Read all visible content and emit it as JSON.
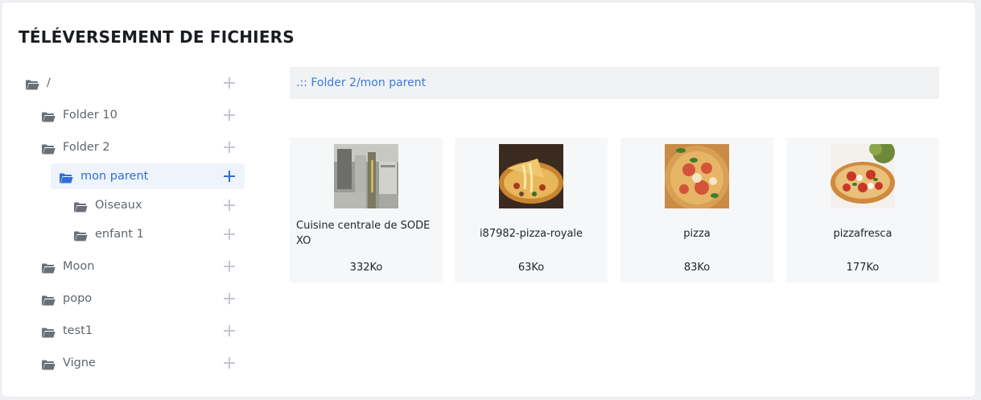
{
  "page": {
    "title": "TÉLÉVERSEMENT DE FICHIERS"
  },
  "tree": {
    "root": {
      "label": "/"
    },
    "items": [
      {
        "label": "Folder 10"
      },
      {
        "label": "Folder 2"
      },
      {
        "label": "mon parent"
      },
      {
        "label": "Oiseaux"
      },
      {
        "label": "enfant 1"
      },
      {
        "label": "Moon"
      },
      {
        "label": "popo"
      },
      {
        "label": "test1"
      },
      {
        "label": "Vigne"
      }
    ],
    "active_item": "mon parent"
  },
  "breadcrumb": {
    "text": ".:: Folder 2/mon parent"
  },
  "files": [
    {
      "name": "Cuisine centrale de SODEXO",
      "size": "332Ko",
      "thumbnail": "kitchen-photo"
    },
    {
      "name": "i87982-pizza-royale",
      "size": "63Ko",
      "thumbnail": "pizza-slice-photo"
    },
    {
      "name": "pizza",
      "size": "83Ko",
      "thumbnail": "pizza-photo"
    },
    {
      "name": "pizzafresca",
      "size": "177Ko",
      "thumbnail": "pizza-fresca-photo"
    }
  ],
  "colors": {
    "accent": "#2f6fd6",
    "folder": "#6b7078",
    "active_background": "#eef3fc"
  }
}
